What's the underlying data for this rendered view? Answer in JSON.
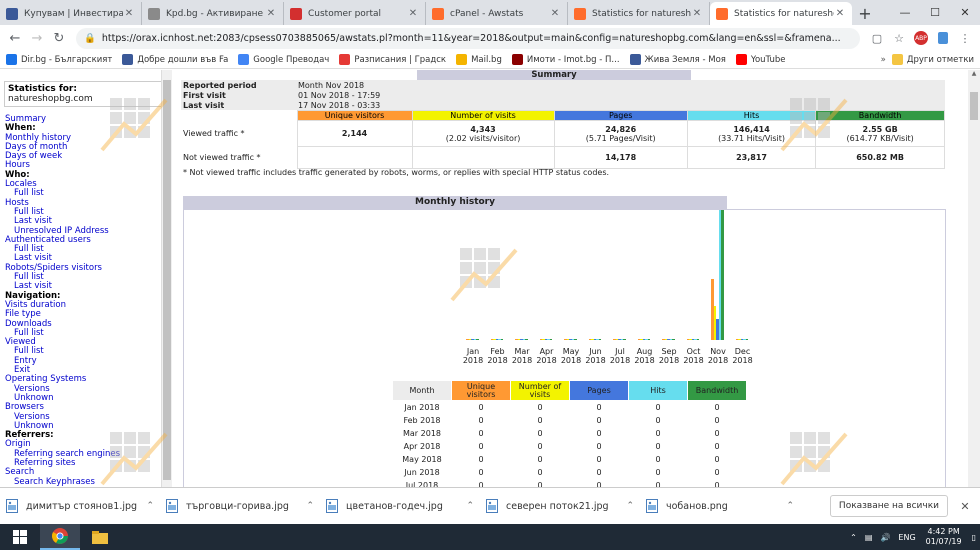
{
  "tabs": [
    {
      "label": "Купувам | Инвестирам",
      "favicon_color": "#3b5998",
      "active": false
    },
    {
      "label": "Kpd.bg - Активиране на",
      "favicon_color": "#8a8a8a",
      "active": false
    },
    {
      "label": "Customer portal",
      "favicon_color": "#d32f2f",
      "active": false
    },
    {
      "label": "cPanel - Awstats",
      "favicon_color": "#ff6c2c",
      "active": false
    },
    {
      "label": "Statistics for natureshop",
      "favicon_color": "#ff6c2c",
      "active": false
    },
    {
      "label": "Statistics for natureshop",
      "favicon_color": "#ff6c2c",
      "active": true
    }
  ],
  "address": "https://orax.icnhost.net:2083/cpsess0703885065/awstats.pl?month=11&year=2018&output=main&config=natureshopbg.com&lang=en&ssl=&framena...",
  "bookmarks": [
    {
      "label": "Dir.bg - Българският",
      "color": "#1a73e8"
    },
    {
      "label": "Добре дошли във Fa",
      "color": "#3b5998"
    },
    {
      "label": "Google Преводач",
      "color": "#4285f4"
    },
    {
      "label": "Разписания | Градск",
      "color": "#e53935"
    },
    {
      "label": "Mail.bg",
      "color": "#f4b400"
    },
    {
      "label": "Имоти - Imot.bg - П...",
      "color": "#8b0000"
    },
    {
      "label": "Жива Земля - Моя",
      "color": "#3b5998"
    },
    {
      "label": "YouTube",
      "color": "#ff0000"
    }
  ],
  "bookmarks_other": "Други отметки",
  "sidebar": {
    "stats_for_label": "Statistics for:",
    "stats_for_value": "natureshopbg.com",
    "menu": [
      {
        "text": "Summary",
        "kind": "link"
      },
      {
        "text": "When:",
        "kind": "section"
      },
      {
        "text": "Monthly history",
        "kind": "link"
      },
      {
        "text": "Days of month",
        "kind": "link"
      },
      {
        "text": "Days of week",
        "kind": "link"
      },
      {
        "text": "Hours",
        "kind": "link"
      },
      {
        "text": "Who:",
        "kind": "section"
      },
      {
        "text": "Locales",
        "kind": "link"
      },
      {
        "text": "Full list",
        "kind": "sub"
      },
      {
        "text": "Hosts",
        "kind": "link"
      },
      {
        "text": "Full list",
        "kind": "sub"
      },
      {
        "text": "Last visit",
        "kind": "sub"
      },
      {
        "text": "Unresolved IP Address",
        "kind": "sub"
      },
      {
        "text": "Authenticated users",
        "kind": "link"
      },
      {
        "text": "Full list",
        "kind": "sub"
      },
      {
        "text": "Last visit",
        "kind": "sub"
      },
      {
        "text": "Robots/Spiders visitors",
        "kind": "link"
      },
      {
        "text": "Full list",
        "kind": "sub"
      },
      {
        "text": "Last visit",
        "kind": "sub"
      },
      {
        "text": "Navigation:",
        "kind": "section"
      },
      {
        "text": "Visits duration",
        "kind": "link"
      },
      {
        "text": "File type",
        "kind": "link"
      },
      {
        "text": "Downloads",
        "kind": "link"
      },
      {
        "text": "Full list",
        "kind": "sub"
      },
      {
        "text": "Viewed",
        "kind": "link"
      },
      {
        "text": "Full list",
        "kind": "sub"
      },
      {
        "text": "Entry",
        "kind": "sub"
      },
      {
        "text": "Exit",
        "kind": "sub"
      },
      {
        "text": "Operating Systems",
        "kind": "link"
      },
      {
        "text": "Versions",
        "kind": "sub"
      },
      {
        "text": "Unknown",
        "kind": "sub"
      },
      {
        "text": "Browsers",
        "kind": "link"
      },
      {
        "text": "Versions",
        "kind": "sub"
      },
      {
        "text": "Unknown",
        "kind": "sub"
      },
      {
        "text": "Referrers:",
        "kind": "section"
      },
      {
        "text": "Origin",
        "kind": "link"
      },
      {
        "text": "Referring search engines",
        "kind": "sub"
      },
      {
        "text": "Referring sites",
        "kind": "sub"
      },
      {
        "text": "Search",
        "kind": "link"
      },
      {
        "text": "Search Keyphrases",
        "kind": "sub"
      }
    ]
  },
  "summary": {
    "header": "Summary",
    "reported_period_label": "Reported period",
    "reported_period_value": "Month Nov 2018",
    "first_visit_label": "First visit",
    "first_visit_value": "01 Nov 2018 - 17:59",
    "last_visit_label": "Last visit",
    "last_visit_value": "17 Nov 2018 - 03:33",
    "columns": [
      {
        "label": "Unique visitors",
        "color": "#ff9933"
      },
      {
        "label": "Number of visits",
        "color": "#f3f300"
      },
      {
        "label": "Pages",
        "color": "#4477dd"
      },
      {
        "label": "Hits",
        "color": "#66ddee"
      },
      {
        "label": "Bandwidth",
        "color": "#339944"
      }
    ],
    "viewed_label": "Viewed traffic *",
    "viewed": [
      {
        "main": "2,144",
        "sub": ""
      },
      {
        "main": "4,343",
        "sub": "(2.02 visits/visitor)"
      },
      {
        "main": "24,826",
        "sub": "(5.71 Pages/Visit)"
      },
      {
        "main": "146,414",
        "sub": "(33.71 Hits/Visit)"
      },
      {
        "main": "2.55 GB",
        "sub": "(614.77 KB/Visit)"
      }
    ],
    "not_viewed_label": "Not viewed traffic *",
    "not_viewed": [
      "",
      "",
      "14,178",
      "23,817",
      "650.82 MB"
    ],
    "note": "* Not viewed traffic includes traffic generated by robots, worms, or replies with special HTTP status codes."
  },
  "monthly": {
    "title": "Monthly history",
    "table_headers": [
      "Month",
      "Unique visitors",
      "Number of visits",
      "Pages",
      "Hits",
      "Bandwidth"
    ],
    "rows": [
      [
        "Jan 2018",
        "0",
        "0",
        "0",
        "0",
        "0"
      ],
      [
        "Feb 2018",
        "0",
        "0",
        "0",
        "0",
        "0"
      ],
      [
        "Mar 2018",
        "0",
        "0",
        "0",
        "0",
        "0"
      ],
      [
        "Apr 2018",
        "0",
        "0",
        "0",
        "0",
        "0"
      ],
      [
        "May 2018",
        "0",
        "0",
        "0",
        "0",
        "0"
      ],
      [
        "Jun 2018",
        "0",
        "0",
        "0",
        "0",
        "0"
      ],
      [
        "Jul 2018",
        "0",
        "0",
        "0",
        "0",
        "0"
      ]
    ]
  },
  "chart_data": {
    "type": "bar",
    "categories": [
      "Jan 2018",
      "Feb 2018",
      "Mar 2018",
      "Apr 2018",
      "May 2018",
      "Jun 2018",
      "Jul 2018",
      "Aug 2018",
      "Sep 2018",
      "Oct 2018",
      "Nov 2018",
      "Dec 2018"
    ],
    "month_labels": [
      "Jan",
      "Feb",
      "Mar",
      "Apr",
      "May",
      "Jun",
      "Jul",
      "Aug",
      "Sep",
      "Oct",
      "Nov",
      "Dec"
    ],
    "year_label": "2018",
    "series": [
      {
        "name": "Unique visitors",
        "color": "#ff9933",
        "values": [
          0,
          0,
          0,
          0,
          0,
          0,
          0,
          0,
          0,
          0,
          2144,
          0
        ]
      },
      {
        "name": "Number of visits",
        "color": "#f3f300",
        "values": [
          0,
          0,
          0,
          0,
          0,
          0,
          0,
          0,
          0,
          0,
          4343,
          0
        ]
      },
      {
        "name": "Pages",
        "color": "#4477dd",
        "values": [
          0,
          0,
          0,
          0,
          0,
          0,
          0,
          0,
          0,
          0,
          24826,
          0
        ]
      },
      {
        "name": "Hits",
        "color": "#66ddee",
        "values": [
          0,
          0,
          0,
          0,
          0,
          0,
          0,
          0,
          0,
          0,
          146414,
          0
        ]
      },
      {
        "name": "Bandwidth",
        "color": "#339944",
        "values": [
          0,
          0,
          0,
          0,
          0,
          0,
          0,
          0,
          0,
          0,
          2.55,
          0
        ]
      }
    ]
  },
  "downloads": [
    "димитър стоянов1.jpg",
    "търговци-горива.jpg",
    "цветанов-годеч.jpg",
    "северен поток21.jpg",
    "чобанов.png"
  ],
  "show_all": "Показване на всички",
  "taskbar": {
    "lang": "ENG",
    "time": "4:42 PM",
    "date": "01/07/19"
  }
}
